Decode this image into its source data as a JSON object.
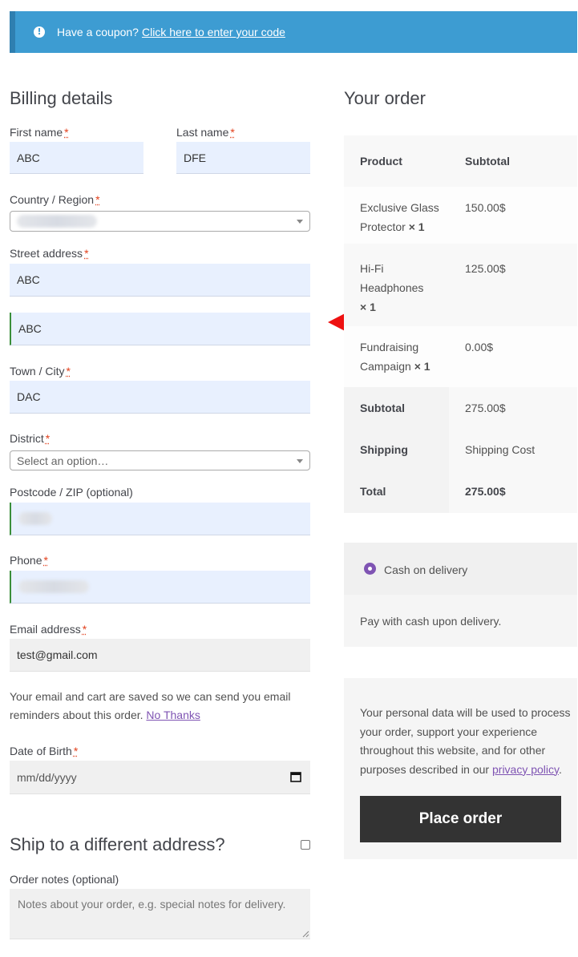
{
  "coupon": {
    "text": "Have a coupon?",
    "link": "Click here to enter your code"
  },
  "billing": {
    "title": "Billing details",
    "first_name": {
      "label": "First name",
      "value": "ABC"
    },
    "last_name": {
      "label": "Last name",
      "value": "DFE"
    },
    "country": {
      "label": "Country / Region"
    },
    "street": {
      "label": "Street address",
      "value1": "ABC",
      "value2": "ABC"
    },
    "city": {
      "label": "Town / City",
      "value": "DAC"
    },
    "district": {
      "label": "District",
      "placeholder": "Select an option…"
    },
    "postcode": {
      "label": "Postcode / ZIP (optional)"
    },
    "phone": {
      "label": "Phone"
    },
    "email": {
      "label": "Email address",
      "value": "test@gmail.com"
    },
    "email_notice": "Your email and cart are saved so we can send you email reminders about this order.",
    "no_thanks": "No Thanks",
    "dob": {
      "label": "Date of Birth",
      "placeholder": "mm/dd/yyyy"
    },
    "required_mark": "*"
  },
  "shipping": {
    "title": "Ship to a different address?",
    "notes_label": "Order notes (optional)",
    "notes_placeholder": "Notes about your order, e.g. special notes for delivery."
  },
  "order": {
    "title": "Your order",
    "col_product": "Product",
    "col_subtotal": "Subtotal",
    "items": [
      {
        "line1": "Exclusive Glass",
        "line2": "Protector",
        "qty": "× 1",
        "price": "150.00$"
      },
      {
        "line1": "Hi-Fi",
        "line2": "Headphones",
        "qty": "× 1",
        "price": "125.00$"
      },
      {
        "line1": "Fundraising",
        "line2": "Campaign",
        "qty": "× 1",
        "price": "0.00$"
      }
    ],
    "subtotal_label": "Subtotal",
    "subtotal_value": "275.00$",
    "shipping_label": "Shipping",
    "shipping_value": "Shipping Cost",
    "total_label": "Total",
    "total_value": "275.00$"
  },
  "payment": {
    "method": "Cash on delivery",
    "description": "Pay with cash upon delivery."
  },
  "privacy": {
    "line1": "Your personal data will be used to process",
    "line2": "your order, support your experience",
    "line3": "throughout this website, and for other",
    "line4_prefix": "purposes described in our",
    "link": "privacy policy",
    "line4_suffix": "."
  },
  "place_order": "Place order",
  "colors": {
    "accent": "#7f54b3",
    "banner": "#3d9cd2",
    "button": "#333333",
    "arrow": "#ee1111"
  }
}
